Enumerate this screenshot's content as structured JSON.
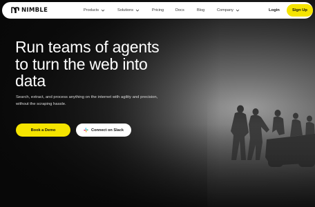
{
  "brand": {
    "name": "NIMBLE",
    "logo_icon": "nimble-logo-icon"
  },
  "nav": {
    "items": [
      {
        "label": "Products",
        "has_dropdown": true
      },
      {
        "label": "Solutions",
        "has_dropdown": true
      },
      {
        "label": "Pricing",
        "has_dropdown": false
      },
      {
        "label": "Docs",
        "has_dropdown": false
      },
      {
        "label": "Blog",
        "has_dropdown": false
      },
      {
        "label": "Company",
        "has_dropdown": true
      }
    ],
    "login_label": "Login",
    "signup_label": "Sign Up"
  },
  "hero": {
    "headline": "Run teams of agents to turn the web into data",
    "subtext": "Search, extract, and process anything on the internet with agility and precision, without the scraping hassle.",
    "primary_cta": "Book a Demo",
    "secondary_cta": "Connect on Slack",
    "secondary_cta_icon": "slack-icon"
  },
  "colors": {
    "accent": "#f5e400",
    "nav_background": "#ffffff",
    "hero_text": "#ffffff"
  }
}
